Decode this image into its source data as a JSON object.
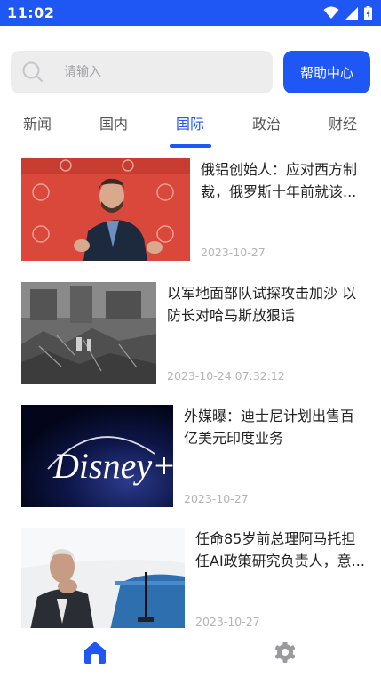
{
  "status": {
    "time": "11:02"
  },
  "search": {
    "placeholder": "请输入",
    "value": ""
  },
  "help": {
    "label": "帮助中心"
  },
  "tabs": [
    {
      "label": "新闻",
      "active": false
    },
    {
      "label": "国内",
      "active": false
    },
    {
      "label": "国际",
      "active": true
    },
    {
      "label": "政治",
      "active": false
    },
    {
      "label": "财经",
      "active": false
    }
  ],
  "news": [
    {
      "title": "俄铝创始人：应对西方制裁，俄罗斯十年前就该...",
      "date": "2023-10-27"
    },
    {
      "title": "以军地面部队试探攻击加沙 以防长对哈马斯放狠话",
      "date": "2023-10-24 07:32:12"
    },
    {
      "title": "外媒曝：迪士尼计划出售百亿美元印度业务",
      "date": "2023-10-27"
    },
    {
      "title": "任命85岁前总理阿马托担任AI政策研究负责人，意...",
      "date": "2023-10-27"
    }
  ],
  "thumb_text": {
    "disney": "Disney+"
  },
  "nav": [
    {
      "icon": "home-icon",
      "active": true
    },
    {
      "icon": "gear-icon",
      "active": false
    }
  ],
  "colors": {
    "primary": "#1f57f5",
    "search_bg": "#ededee",
    "date": "#b4b4b8",
    "inactive_icon": "#9a9a9e"
  }
}
